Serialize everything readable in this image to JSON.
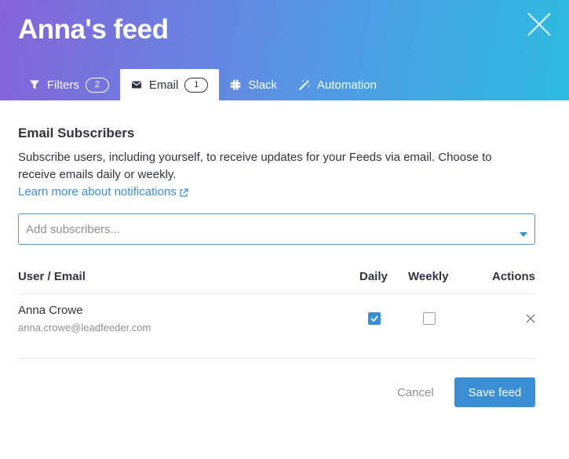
{
  "modal": {
    "title": "Anna's feed"
  },
  "tabs": [
    {
      "label": "Filters",
      "badge": "2",
      "icon": "filter-icon",
      "active": false
    },
    {
      "label": "Email",
      "badge": "1",
      "icon": "envelope-icon",
      "active": true
    },
    {
      "label": "Slack",
      "icon": "slack-icon",
      "active": false
    },
    {
      "label": "Automation",
      "icon": "magic-wand-icon",
      "active": false
    }
  ],
  "email": {
    "section_title": "Email Subscribers",
    "description": "Subscribe users, including yourself, to receive updates for your Feeds via email. Choose to receive emails daily or weekly.",
    "learn_more": "Learn more about notifications",
    "add_placeholder": "Add subscribers..."
  },
  "table": {
    "headers": {
      "user": "User / Email",
      "daily": "Daily",
      "weekly": "Weekly",
      "actions": "Actions"
    },
    "rows": [
      {
        "name": "Anna Crowe",
        "email": "anna.crowe@leadfeeder.com",
        "daily": true,
        "weekly": false
      }
    ]
  },
  "footer": {
    "cancel_label": "Cancel",
    "save_label": "Save feed"
  },
  "colors": {
    "accent": "#3a8fd4",
    "header_gradient_start": "#8463d8",
    "header_gradient_end": "#2ebce0"
  }
}
